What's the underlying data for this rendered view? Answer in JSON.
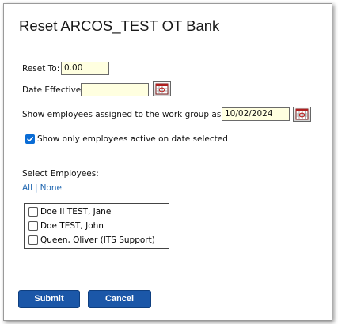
{
  "dialog": {
    "title": "Reset ARCOS_TEST OT Bank"
  },
  "form": {
    "reset_to_label": "Reset To:",
    "reset_to_value": "0.00",
    "date_effective_label": "Date Effective:",
    "date_effective_value": "",
    "workgroup_label": "Show employees assigned to the work group as of:",
    "workgroup_date_value": "10/02/2024",
    "active_only_label": "Show only employees active on date selected",
    "active_only_checked": true
  },
  "employees": {
    "section_label": "Select Employees:",
    "all_link": "All",
    "separator": "|",
    "none_link": "None",
    "list": [
      {
        "name": "Doe II TEST, Jane",
        "checked": false
      },
      {
        "name": "Doe TEST, John",
        "checked": false
      },
      {
        "name": "Queen, Oliver (ITS Support)",
        "checked": false
      }
    ]
  },
  "buttons": {
    "submit_label": "Submit",
    "cancel_label": "Cancel"
  },
  "colors": {
    "input_bg": "#ffffe0",
    "link": "#1f66b0",
    "button_bg": "#1b57a8",
    "checkbox_checked": "#0a6cd5"
  },
  "icons": {
    "calendar": "calendar-icon",
    "check": "checkmark-icon"
  }
}
